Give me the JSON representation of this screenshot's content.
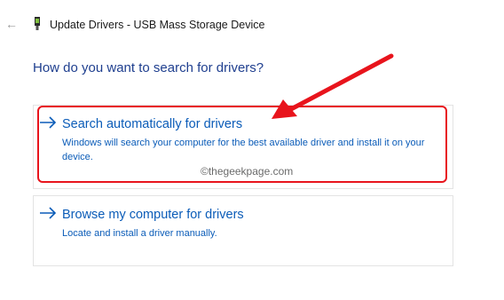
{
  "window": {
    "title": "Update Drivers - USB Mass Storage Device",
    "back_icon": "back-arrow-icon",
    "device_icon": "usb-device-icon"
  },
  "main": {
    "question": "How do you want to search for drivers?",
    "options": [
      {
        "title": "Search automatically for drivers",
        "description": "Windows will search your computer for the best available driver and install it on your device.",
        "icon": "arrow-right-icon"
      },
      {
        "title": "Browse my computer for drivers",
        "description": "Locate and install a driver manually.",
        "icon": "arrow-right-icon"
      }
    ]
  },
  "watermark": "©thegeekpage.com",
  "colors": {
    "link": "#0b5cb8",
    "heading": "#1f3f8f",
    "highlight": "#e8141c"
  }
}
